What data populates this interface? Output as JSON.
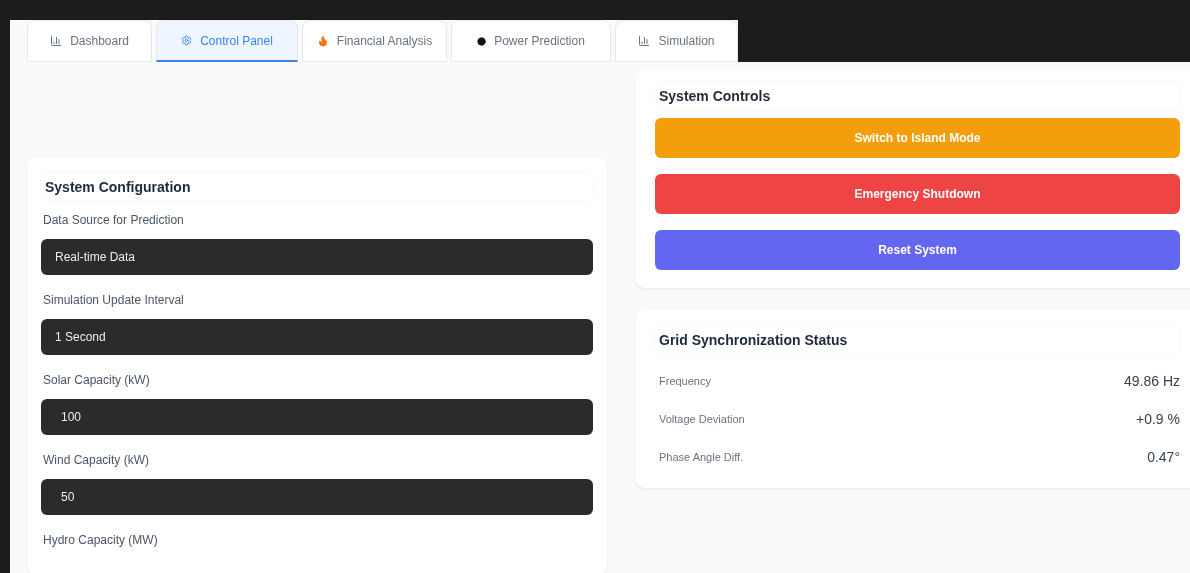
{
  "tabs": [
    {
      "label": "Dashboard",
      "selected": false
    },
    {
      "label": "Control Panel",
      "selected": true
    },
    {
      "label": "Financial Analysis",
      "selected": false
    },
    {
      "label": "Power Prediction",
      "selected": false
    },
    {
      "label": "Simulation",
      "selected": false
    }
  ],
  "system_configuration": {
    "title": "System Configuration",
    "fields": [
      {
        "label": "Data Source for Prediction",
        "kind": "select",
        "value": "Real-time Data"
      },
      {
        "label": "Simulation Update Interval",
        "kind": "select",
        "value": "1 Second"
      },
      {
        "label": "Solar Capacity (kW)",
        "kind": "number",
        "value": "100"
      },
      {
        "label": "Wind Capacity (kW)",
        "kind": "number",
        "value": "50"
      },
      {
        "label": "Hydro Capacity (MW)"
      }
    ]
  },
  "system_controls": {
    "title": "System Controls",
    "buttons": [
      {
        "label": "Switch to Island Mode",
        "color": "#f59e0b"
      },
      {
        "label": "Emergency Shutdown",
        "color": "#ef4444"
      },
      {
        "label": "Reset System",
        "color": "#6366f1"
      }
    ]
  },
  "grid_sync": {
    "title": "Grid Synchronization Status",
    "rows": [
      {
        "label": "Frequency",
        "value": "49.86 Hz"
      },
      {
        "label": "Voltage Deviation",
        "value": "+0.9 %"
      },
      {
        "label": "Phase Angle Diff.",
        "value": "0.47°"
      }
    ]
  }
}
